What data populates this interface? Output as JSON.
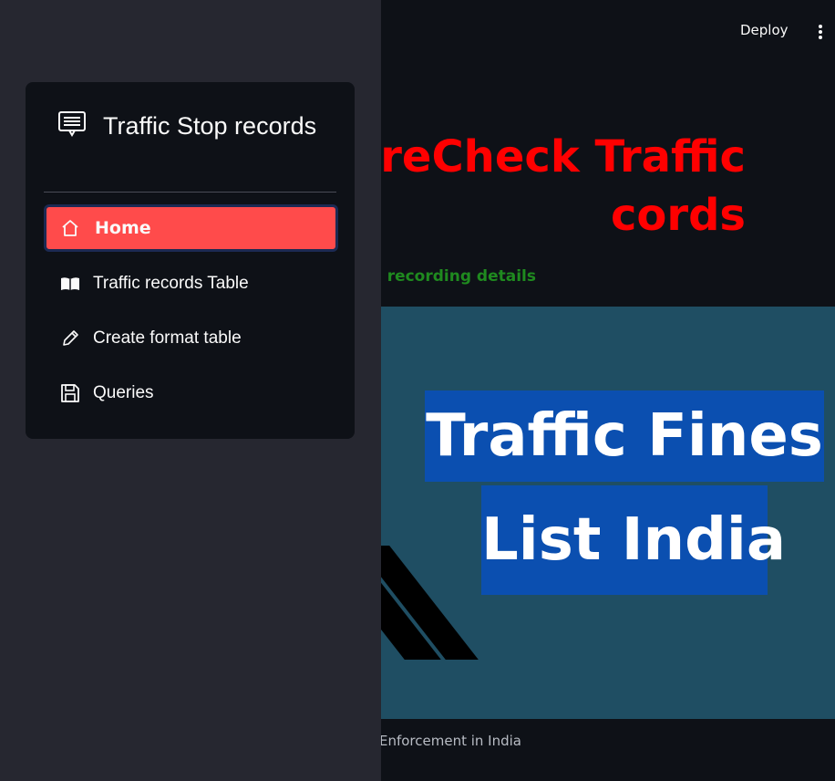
{
  "toolbar": {
    "deploy_label": "Deploy",
    "menu_icon": "vertical-dots-icon"
  },
  "main": {
    "title_line1": "ecureCheck Traffic",
    "title_line2": "cords",
    "subtitle": "fic recording details",
    "banner": {
      "line1": "Traffic Fines",
      "line2": "List India"
    },
    "caption": "Enforcement in India",
    "colors": {
      "title": "#ff0000",
      "subtitle": "#1f8a1f",
      "banner_bg": "#1f4e63",
      "banner_text_bg": "#0b4fb0"
    }
  },
  "sidebar": {
    "header_icon": "document-list-icon",
    "header_title": "Traffic Stop records",
    "items": [
      {
        "label": "Home",
        "icon": "house-icon",
        "active": true
      },
      {
        "label": "Traffic records Table",
        "icon": "open-book-icon",
        "active": false
      },
      {
        "label": "Create format table",
        "icon": "pencil-icon",
        "active": false
      },
      {
        "label": "Queries",
        "icon": "floppy-disk-icon",
        "active": false
      }
    ],
    "colors": {
      "background": "#262730",
      "card": "#0e1117",
      "active_item": "#ff4b4b"
    }
  }
}
